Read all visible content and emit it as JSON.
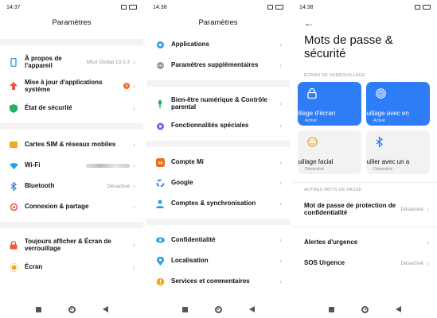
{
  "panel1": {
    "time": "14:37",
    "title": "Paramètres",
    "items": [
      {
        "label": "À propos de l'appareil",
        "value": "MIUI Global 13.0.3"
      },
      {
        "label": "Mise à jour d'applications système",
        "badge": "1"
      },
      {
        "label": "État de sécurité"
      },
      {
        "label": "Cartes SIM & réseaux mobiles"
      },
      {
        "label": "Wi-Fi"
      },
      {
        "label": "Bluetooth",
        "value": "Désactivé"
      },
      {
        "label": "Connexion & partage"
      },
      {
        "label": "Toujours afficher & Écran de verrouillage"
      },
      {
        "label": "Écran"
      }
    ]
  },
  "panel2": {
    "time": "14:38",
    "title": "Paramètres",
    "items": [
      {
        "label": "Applications"
      },
      {
        "label": "Paramètres supplémentaires"
      },
      {
        "label": "Bien-être numérique & Contrôle parental"
      },
      {
        "label": "Fonctionnalités spéciales"
      },
      {
        "label": "Compte Mi"
      },
      {
        "label": "Google"
      },
      {
        "label": "Comptes & synchronisation"
      },
      {
        "label": "Confidentialité"
      },
      {
        "label": "Localisation"
      },
      {
        "label": "Services et commentaires"
      }
    ]
  },
  "panel3": {
    "time": "14:38",
    "title": "Mots de passe & sécurité",
    "section1": "ÉCRAN DE VERROUILLAGE",
    "tiles": [
      {
        "label": "uillage d'écran",
        "status": "Activé"
      },
      {
        "label": "ouillage avec en",
        "status": "Activé"
      },
      {
        "label": "ouillage facial",
        "status": "Désactivé"
      },
      {
        "label": "ouiller avec un a",
        "status": "Désactivé"
      }
    ],
    "section2": "AUTRES MOTS DE PASSE",
    "items": [
      {
        "label": "Mot de passe de protection de confidentialité",
        "value": "Désactivé"
      },
      {
        "label": "Alertes d'urgence"
      },
      {
        "label": "SOS Urgence",
        "value": "Désactivé"
      }
    ]
  },
  "colors": {
    "accent": "#2e7df6",
    "badge": "#f26a1b",
    "tile_off": "#f2f2f2"
  },
  "chevron": "›"
}
